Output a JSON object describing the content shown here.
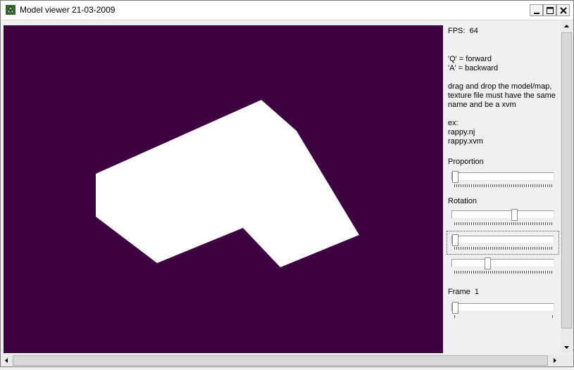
{
  "window": {
    "title": "Model viewer 21-03-2009"
  },
  "panel": {
    "fps_label": "FPS:",
    "fps_value": "64",
    "help_forward": "'Q' = forward",
    "help_backward": "'A' = backward",
    "help_drag_1": "drag and drop the model/map,",
    "help_drag_2": "texture file must have the same",
    "help_drag_3": "name and be a xvm",
    "example_label": "ex:",
    "example_model": "rappy.nj",
    "example_texture": "rappy.xvm",
    "proportion_label": "Proportion",
    "rotation_label": "Rotation",
    "frame_label": "Frame",
    "frame_value": "1"
  },
  "sliders": {
    "proportion": 0.0,
    "rotation_x": 0.62,
    "rotation_y": 0.0,
    "rotation_z": 0.34,
    "frame": 0.0
  },
  "colors": {
    "viewport_bg": "#3d0040",
    "model_fill": "#ffffff"
  }
}
